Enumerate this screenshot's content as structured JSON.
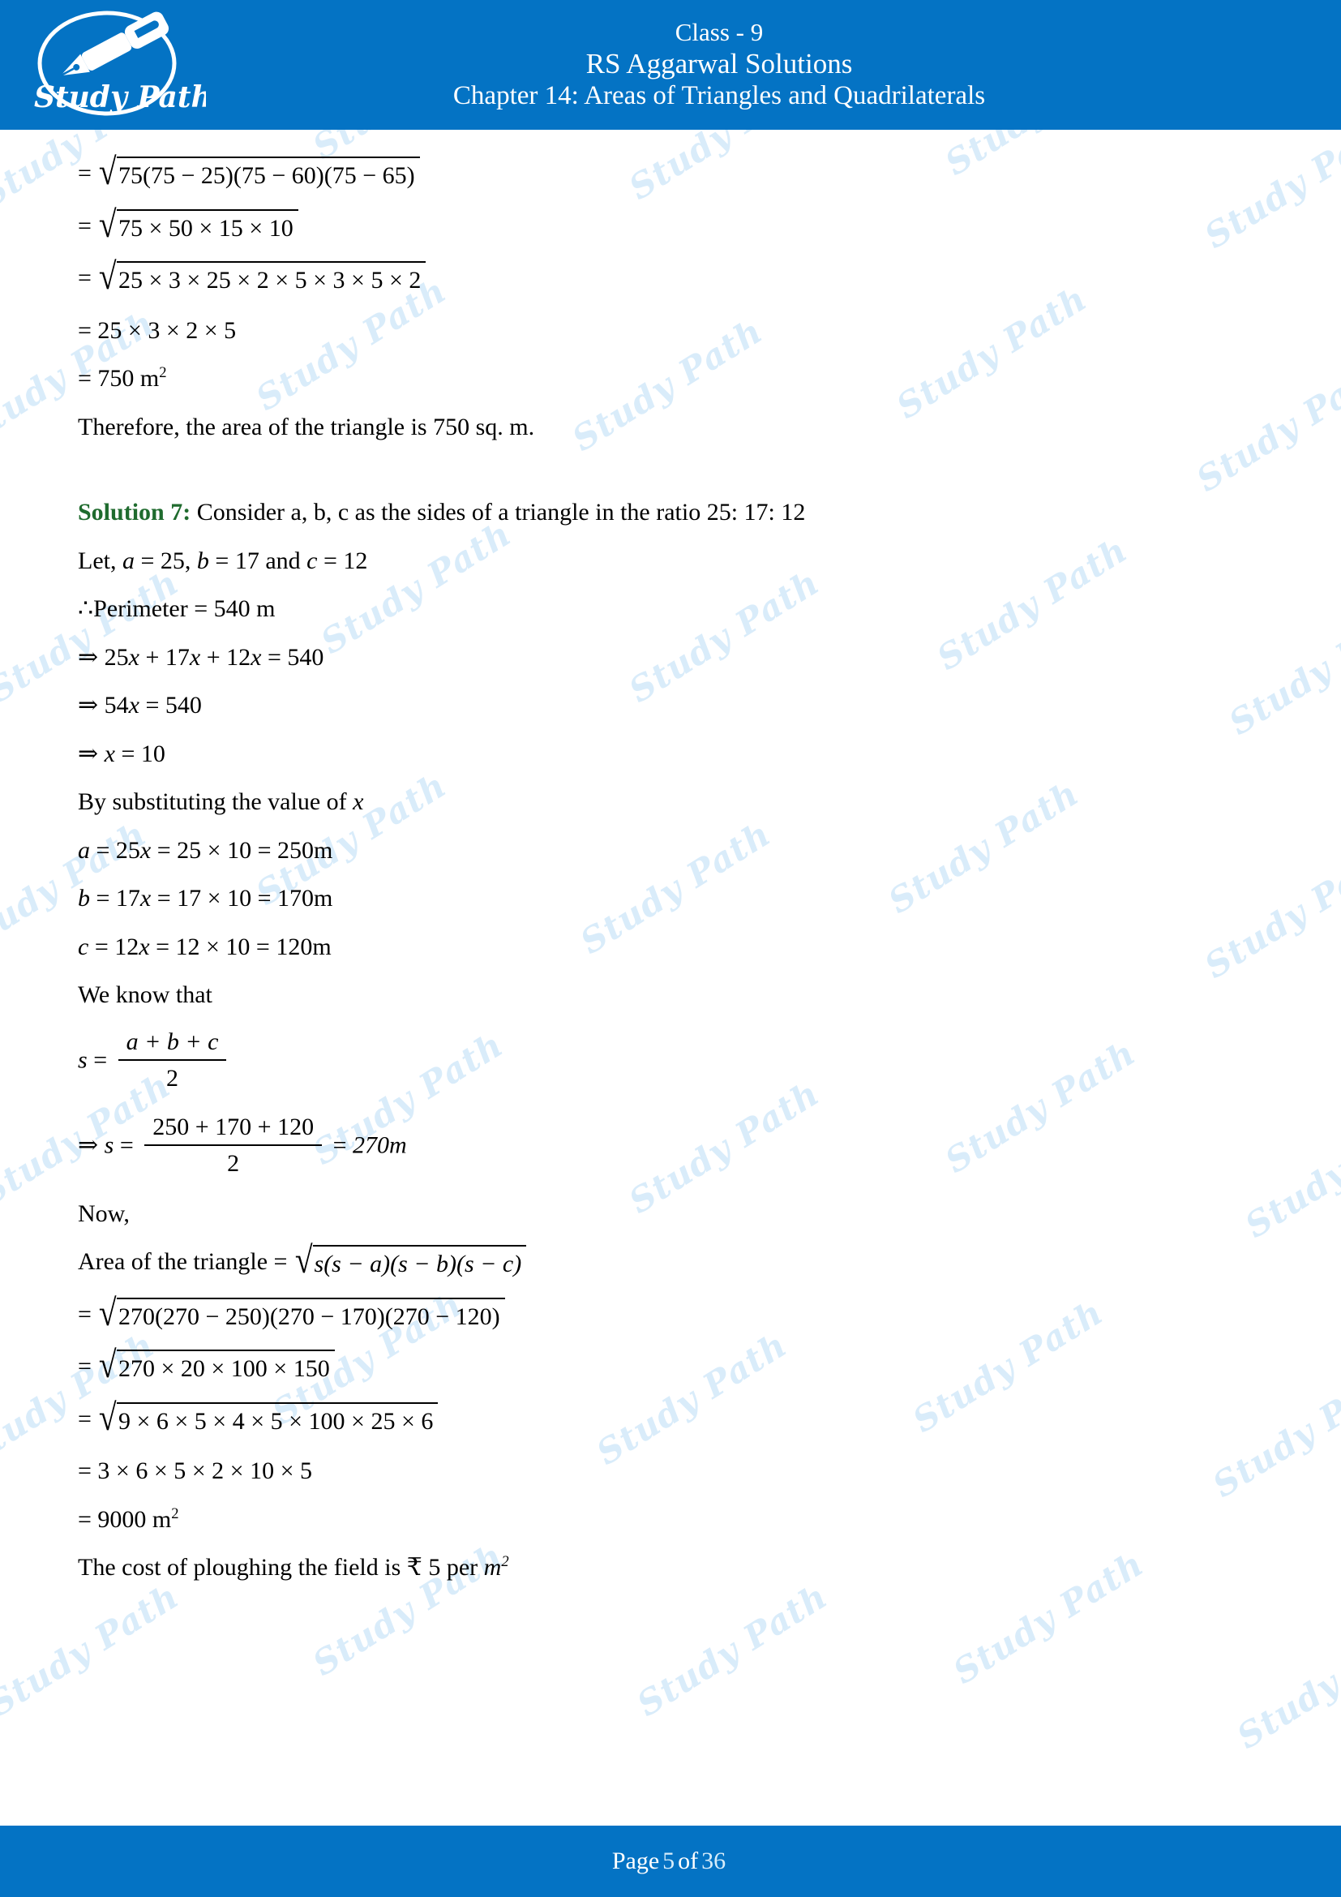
{
  "header": {
    "logo_text": "Study Path",
    "logo_icon": "fountain-pen-icon",
    "class_line": "Class - 9",
    "book_line": "RS Aggarwal Solutions",
    "chapter_line": "Chapter 14: Areas of Triangles and Quadrilaterals",
    "bg_color": "#0473c4"
  },
  "watermark": {
    "text": "Study Path",
    "color": "#d9ecfa"
  },
  "colors": {
    "accent_blue": "#0473c4",
    "solution_green": "#1f6b2e",
    "body_text": "#000000"
  },
  "body": {
    "eq1": {
      "lhs": "=",
      "radicand": "75(75 − 25)(75 − 60)(75 − 65)"
    },
    "eq2": {
      "lhs": "=",
      "radicand": "75 × 50 × 15 × 10"
    },
    "eq3": {
      "lhs": "=",
      "radicand": "25 × 3 × 25 × 2 × 5 × 3 × 5 × 2"
    },
    "eq4": "= 25 × 3 × 2 × 5",
    "eq5_prefix": "= 750 m",
    "eq5_sup": "2",
    "conclusion1": "Therefore, the area of the triangle is 750 sq. m.",
    "solution_label": "Solution 7:",
    "solution_intro": " Consider a, b, c as the sides of a triangle in the ratio 25: 17: 12",
    "let_line": {
      "prefix": "Let, ",
      "a_var": "a",
      "a_val": " = 25, ",
      "b_var": "b",
      "b_val": " = 17 and ",
      "c_var": "c",
      "c_val": " = 12"
    },
    "perimeter_line": "∴Perimeter = 540 m",
    "step1": {
      "arrow": "⇒ ",
      "t1": "25",
      "v1": "x",
      "t2": " + ",
      "t3": "17",
      "v2": "x",
      "t4": " + ",
      "t5": "12",
      "v3": "x",
      "t6": " = 540"
    },
    "step2": {
      "arrow": "⇒ ",
      "t1": "54",
      "v1": "x",
      "t2": " = 540"
    },
    "step3": {
      "arrow": "⇒ ",
      "v1": "x",
      "t1": " = 10"
    },
    "subst_line": {
      "prefix": "By substituting the value of ",
      "var": "x"
    },
    "side_a": {
      "var": "a",
      "eq1": " = 25",
      "xvar": "x",
      "eq2": " = 25 × 10 = 250m"
    },
    "side_b": {
      "var": "b",
      "eq1": " = 17",
      "xvar": "x",
      "eq2": " = 17 × 10 = 170m"
    },
    "side_c": {
      "var": "c",
      "eq1": " = 12",
      "xvar": "x",
      "eq2": " = 12 × 10 = 120m"
    },
    "we_know": "We know that",
    "s_formula": {
      "lhs_var": "s",
      "eq": " = ",
      "numerator": "a + b + c",
      "denominator": "2"
    },
    "s_value": {
      "arrow": "⇒ ",
      "lhs_var": "s",
      "eq": " = ",
      "numerator": "250 + 170 + 120",
      "denominator": "2",
      "result_eq": " = ",
      "result": "270m"
    },
    "now_line": "Now,",
    "area_formula": {
      "label": "Area of the triangle = ",
      "radicand": "s(s − a)(s − b)(s − c)"
    },
    "area_eq1": {
      "lhs": "=",
      "radicand": "270(270 − 250)(270 − 170)(270 − 120)"
    },
    "area_eq2": {
      "lhs": "=",
      "radicand": "270 × 20 × 100 × 150"
    },
    "area_eq3": {
      "lhs": "=",
      "radicand": "9 × 6 × 5 × 4 × 5 × 100 × 25 × 6"
    },
    "area_eq4": "= 3 × 6 × 5 × 2 × 10 × 5",
    "area_eq5_prefix": "= 9000 m",
    "area_eq5_sup": "2",
    "cost_line": {
      "prefix": "The cost of ploughing the field is ₹ 5 per ",
      "unit_var": "m",
      "unit_sup": "2"
    }
  },
  "footer": {
    "page_word": "Page ",
    "page_number": "5",
    "of_word": " of ",
    "total_pages": "36"
  }
}
